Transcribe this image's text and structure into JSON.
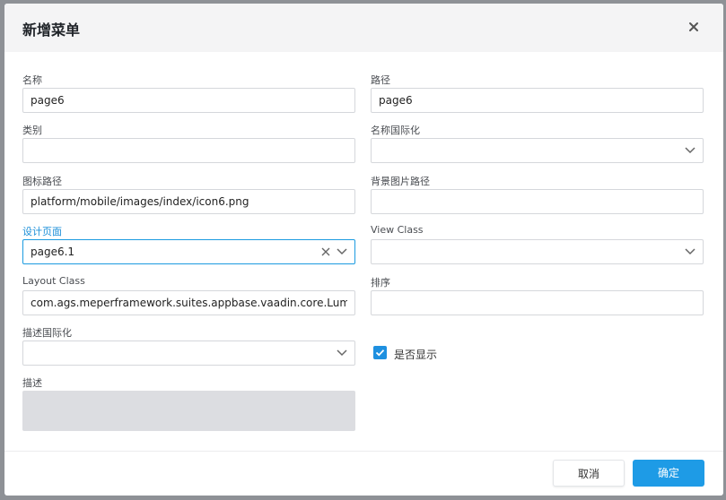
{
  "dialog": {
    "title": "新增菜单",
    "close_icon": "close-icon"
  },
  "form": {
    "name": {
      "label": "名称",
      "value": "page6"
    },
    "path": {
      "label": "路径",
      "value": "page6"
    },
    "category": {
      "label": "类别",
      "value": ""
    },
    "name_i18n": {
      "label": "名称国际化",
      "value": ""
    },
    "icon_path": {
      "label": "图标路径",
      "value": "platform/mobile/images/index/icon6.png"
    },
    "bg_image_path": {
      "label": "背景图片路径",
      "value": ""
    },
    "design_page": {
      "label": "设计页面",
      "value": "page6.1"
    },
    "view_class": {
      "label": "View Class",
      "value": ""
    },
    "layout_class": {
      "label": "Layout Class",
      "value": "com.ags.meperframework.suites.appbase.vaadin.core.LumosMobile"
    },
    "order": {
      "label": "排序",
      "value": ""
    },
    "desc_i18n": {
      "label": "描述国际化",
      "value": ""
    },
    "is_visible": {
      "label": "是否显示",
      "checked": true
    },
    "description": {
      "label": "描述",
      "value": ""
    }
  },
  "footer": {
    "cancel_label": "取消",
    "confirm_label": "确定"
  },
  "colors": {
    "accent": "#1e9be6",
    "focus_label": "#1a8ed8",
    "backdrop": "#8e9196"
  }
}
